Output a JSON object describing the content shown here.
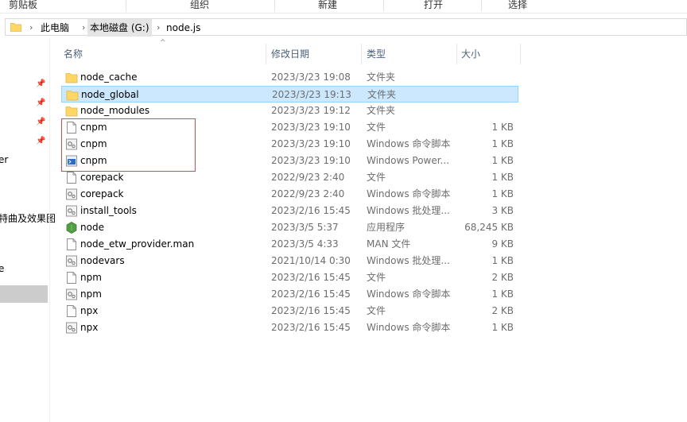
{
  "ribbon": {
    "groups": [
      "剪贴板",
      "组织",
      "新建",
      "打开",
      "选择"
    ]
  },
  "address": {
    "crumbs": [
      "此电脑",
      "本地磁盘 (G:)",
      "node.js"
    ]
  },
  "nav": {
    "partial_labels": [
      "er",
      "特曲及效果图",
      "e"
    ]
  },
  "columns": {
    "name": "名称",
    "date": "修改日期",
    "type": "类型",
    "size": "大小"
  },
  "files": [
    {
      "name": "node_cache",
      "date": "2023/3/23 19:08",
      "type": "文件夹",
      "size": "",
      "icon": "folder-icon"
    },
    {
      "name": "node_global",
      "date": "2023/3/23 19:13",
      "type": "文件夹",
      "size": "",
      "icon": "folder-icon",
      "selected": true
    },
    {
      "name": "node_modules",
      "date": "2023/3/23 19:12",
      "type": "文件夹",
      "size": "",
      "icon": "folder-icon"
    },
    {
      "name": "cnpm",
      "date": "2023/3/23 19:10",
      "type": "文件",
      "size": "1 KB",
      "icon": "file-icon"
    },
    {
      "name": "cnpm",
      "date": "2023/3/23 19:10",
      "type": "Windows 命令脚本",
      "size": "1 KB",
      "icon": "script-icon"
    },
    {
      "name": "cnpm",
      "date": "2023/3/23 19:10",
      "type": "Windows Power...",
      "size": "1 KB",
      "icon": "powershell-icon"
    },
    {
      "name": "corepack",
      "date": "2022/9/23 2:40",
      "type": "文件",
      "size": "1 KB",
      "icon": "file-icon"
    },
    {
      "name": "corepack",
      "date": "2022/9/23 2:40",
      "type": "Windows 命令脚本",
      "size": "1 KB",
      "icon": "script-icon"
    },
    {
      "name": "install_tools",
      "date": "2023/2/16 15:45",
      "type": "Windows 批处理...",
      "size": "3 KB",
      "icon": "script-icon"
    },
    {
      "name": "node",
      "date": "2023/3/5 5:37",
      "type": "应用程序",
      "size": "68,245 KB",
      "icon": "node-app-icon"
    },
    {
      "name": "node_etw_provider.man",
      "date": "2023/3/5 4:33",
      "type": "MAN 文件",
      "size": "9 KB",
      "icon": "file-icon"
    },
    {
      "name": "nodevars",
      "date": "2021/10/14 0:30",
      "type": "Windows 批处理...",
      "size": "1 KB",
      "icon": "script-icon"
    },
    {
      "name": "npm",
      "date": "2023/2/16 15:45",
      "type": "文件",
      "size": "2 KB",
      "icon": "file-icon"
    },
    {
      "name": "npm",
      "date": "2023/2/16 15:45",
      "type": "Windows 命令脚本",
      "size": "1 KB",
      "icon": "script-icon"
    },
    {
      "name": "npx",
      "date": "2023/2/16 15:45",
      "type": "文件",
      "size": "2 KB",
      "icon": "file-icon"
    },
    {
      "name": "npx",
      "date": "2023/2/16 15:45",
      "type": "Windows 命令脚本",
      "size": "1 KB",
      "icon": "script-icon"
    }
  ],
  "colors": {
    "selection_bg": "#cce8ff",
    "highlight_box": "#e0474c",
    "folder": "#ffd766"
  }
}
